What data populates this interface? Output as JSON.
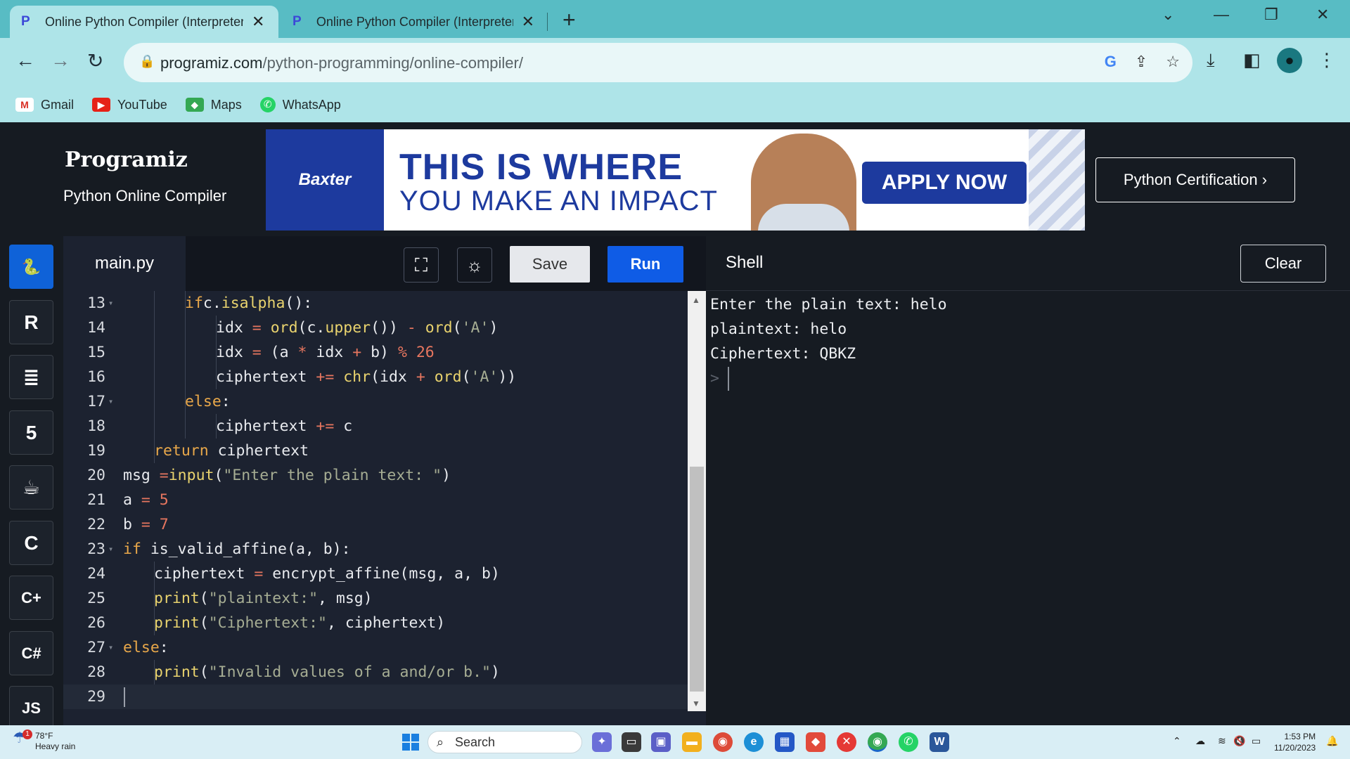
{
  "browser": {
    "tabs": [
      {
        "title": "Online Python Compiler (Interpreter)",
        "active": true
      },
      {
        "title": "Online Python Compiler (Interpreter)",
        "active": false
      }
    ],
    "url_host": "programiz.com",
    "url_path": "/python-programming/online-compiler/",
    "bookmarks": [
      {
        "label": "Gmail",
        "icon": "gmail-icon"
      },
      {
        "label": "YouTube",
        "icon": "youtube-icon"
      },
      {
        "label": "Maps",
        "icon": "maps-icon"
      },
      {
        "label": "WhatsApp",
        "icon": "whatsapp-icon"
      }
    ]
  },
  "header": {
    "logo": "Programiz",
    "subtitle": "Python Online Compiler",
    "certification_label": "Python Certification ›",
    "ad": {
      "brand": "Baxter",
      "headline": "THIS IS WHERE",
      "subheadline": "YOU MAKE AN IMPACT",
      "cta": "APPLY NOW"
    }
  },
  "languages": [
    {
      "name": "python-icon",
      "glyph": "🐍",
      "active": true
    },
    {
      "name": "r-icon",
      "glyph": "R",
      "active": false
    },
    {
      "name": "sql-icon",
      "glyph": "≣",
      "active": false
    },
    {
      "name": "html-icon",
      "glyph": "5",
      "active": false
    },
    {
      "name": "java-icon",
      "glyph": "☕",
      "active": false
    },
    {
      "name": "c-icon",
      "glyph": "C",
      "active": false
    },
    {
      "name": "cpp-icon",
      "glyph": "C+",
      "active": false
    },
    {
      "name": "csharp-icon",
      "glyph": "C#",
      "active": false
    },
    {
      "name": "js-icon",
      "glyph": "JS",
      "active": false
    }
  ],
  "editor": {
    "filename": "main.py",
    "save_label": "Save",
    "run_label": "Run",
    "lines": [
      {
        "n": "13",
        "fold": true,
        "indent": 2,
        "tokens": [
          [
            "kw",
            "if"
          ],
          [
            "",
            "c."
          ],
          [
            "fn",
            "isalpha"
          ],
          [
            "",
            "():"
          ]
        ]
      },
      {
        "n": "14",
        "fold": false,
        "indent": 3,
        "tokens": [
          [
            "",
            "idx "
          ],
          [
            "op",
            "="
          ],
          [
            "",
            " "
          ],
          [
            "fn",
            "ord"
          ],
          [
            "",
            "(c."
          ],
          [
            "fn",
            "upper"
          ],
          [
            "",
            "()) "
          ],
          [
            "op",
            "-"
          ],
          [
            "",
            " "
          ],
          [
            "fn",
            "ord"
          ],
          [
            "",
            "("
          ],
          [
            "st",
            "'A'"
          ],
          [
            "",
            ")"
          ]
        ]
      },
      {
        "n": "15",
        "fold": false,
        "indent": 3,
        "tokens": [
          [
            "",
            "idx "
          ],
          [
            "op",
            "="
          ],
          [
            "",
            " (a "
          ],
          [
            "op",
            "*"
          ],
          [
            "",
            " idx "
          ],
          [
            "op",
            "+"
          ],
          [
            "",
            " b) "
          ],
          [
            "op",
            "%"
          ],
          [
            "",
            " "
          ],
          [
            "nm",
            "26"
          ]
        ]
      },
      {
        "n": "16",
        "fold": false,
        "indent": 3,
        "tokens": [
          [
            "",
            "ciphertext "
          ],
          [
            "op",
            "+="
          ],
          [
            "",
            " "
          ],
          [
            "fn",
            "chr"
          ],
          [
            "",
            "(idx "
          ],
          [
            "op",
            "+"
          ],
          [
            "",
            " "
          ],
          [
            "fn",
            "ord"
          ],
          [
            "",
            "("
          ],
          [
            "st",
            "'A'"
          ],
          [
            "",
            "))"
          ]
        ]
      },
      {
        "n": "17",
        "fold": true,
        "indent": 2,
        "tokens": [
          [
            "kw",
            "else"
          ],
          [
            "",
            ":"
          ]
        ]
      },
      {
        "n": "18",
        "fold": false,
        "indent": 3,
        "tokens": [
          [
            "",
            "ciphertext "
          ],
          [
            "op",
            "+="
          ],
          [
            "",
            " c"
          ]
        ]
      },
      {
        "n": "19",
        "fold": false,
        "indent": 1,
        "tokens": [
          [
            "kw",
            "return"
          ],
          [
            "",
            " ciphertext"
          ]
        ]
      },
      {
        "n": "20",
        "fold": false,
        "indent": 0,
        "tokens": [
          [
            "",
            "msg "
          ],
          [
            "op",
            "="
          ],
          [
            "fn",
            "input"
          ],
          [
            "",
            "("
          ],
          [
            "st",
            "\"Enter the plain text: \""
          ],
          [
            "",
            ")"
          ]
        ]
      },
      {
        "n": "21",
        "fold": false,
        "indent": 0,
        "tokens": [
          [
            "",
            "a "
          ],
          [
            "op",
            "="
          ],
          [
            "",
            " "
          ],
          [
            "nm",
            "5"
          ]
        ]
      },
      {
        "n": "22",
        "fold": false,
        "indent": 0,
        "tokens": [
          [
            "",
            "b "
          ],
          [
            "op",
            "="
          ],
          [
            "",
            " "
          ],
          [
            "nm",
            "7"
          ]
        ]
      },
      {
        "n": "23",
        "fold": true,
        "indent": 0,
        "tokens": [
          [
            "kw",
            "if"
          ],
          [
            "",
            " is_valid_affine(a, b):"
          ]
        ]
      },
      {
        "n": "24",
        "fold": false,
        "indent": 1,
        "tokens": [
          [
            "",
            "ciphertext "
          ],
          [
            "op",
            "="
          ],
          [
            "",
            " encrypt_affine(msg, a, b)"
          ]
        ]
      },
      {
        "n": "25",
        "fold": false,
        "indent": 1,
        "tokens": [
          [
            "fn",
            "print"
          ],
          [
            "",
            "("
          ],
          [
            "st",
            "\"plaintext:\""
          ],
          [
            "",
            ", msg)"
          ]
        ]
      },
      {
        "n": "26",
        "fold": false,
        "indent": 1,
        "tokens": [
          [
            "fn",
            "print"
          ],
          [
            "",
            "("
          ],
          [
            "st",
            "\"Ciphertext:\""
          ],
          [
            "",
            ", ciphertext)"
          ]
        ]
      },
      {
        "n": "27",
        "fold": true,
        "indent": 0,
        "tokens": [
          [
            "kw",
            "else"
          ],
          [
            "",
            ":"
          ]
        ]
      },
      {
        "n": "28",
        "fold": false,
        "indent": 1,
        "tokens": [
          [
            "fn",
            "print"
          ],
          [
            "",
            "("
          ],
          [
            "st",
            "\"Invalid values of a and/or b.\""
          ],
          [
            "",
            ")"
          ]
        ]
      },
      {
        "n": "29",
        "fold": false,
        "indent": 0,
        "tokens": [],
        "current": true
      }
    ]
  },
  "shell": {
    "title": "Shell",
    "clear_label": "Clear",
    "output": [
      "Enter the plain text: helo",
      "plaintext: helo",
      "Ciphertext: QBKZ"
    ],
    "prompt": ">"
  },
  "taskbar": {
    "temperature": "78°F",
    "weather": "Heavy rain",
    "weather_badge": "1",
    "search_placeholder": "Search",
    "time": "1:53 PM",
    "date": "11/20/2023"
  }
}
